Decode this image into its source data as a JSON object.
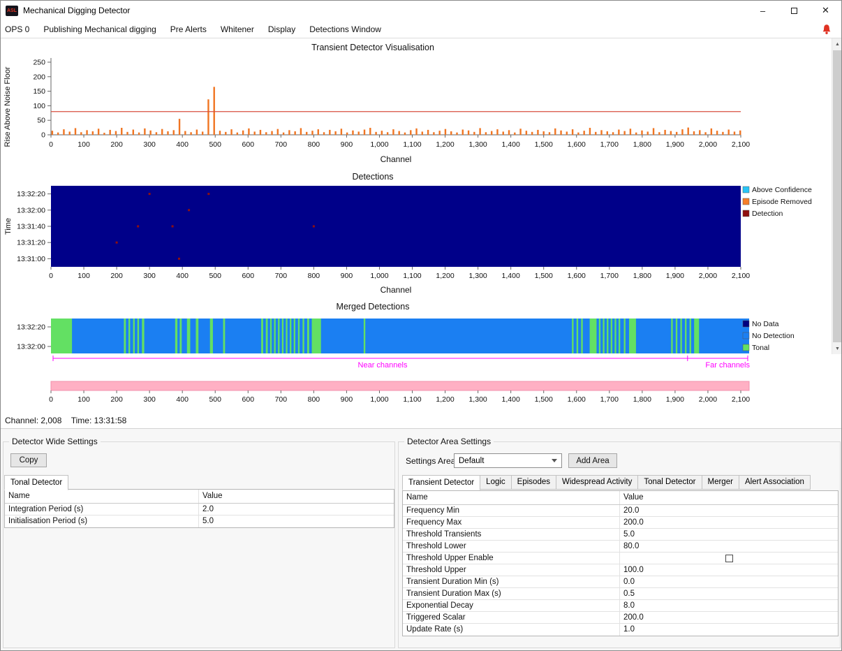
{
  "window": {
    "title": "Mechanical Digging Detector",
    "icon_text": "ASL"
  },
  "icons": {
    "minimize": "–",
    "maximize": "maximize-box",
    "close": "✕",
    "scroll_up": "▲",
    "scroll_down": "▼",
    "bell": "alert-bell",
    "combo_chevron": "chevron-down"
  },
  "menu": {
    "items": [
      "OPS 0",
      "Publishing Mechanical digging",
      "Pre Alerts",
      "Whitener",
      "Display",
      "Detections Window"
    ]
  },
  "status_bar": {
    "channel": "Channel: 2,008",
    "time": "Time: 13:31:58"
  },
  "chart_data": [
    {
      "id": "transient",
      "type": "bar",
      "title": "Transient Detector Visualisation",
      "xlabel": "Channel",
      "ylabel": "Rise Above Noise Floor",
      "xlim": [
        0,
        2100
      ],
      "ylim": [
        0,
        260
      ],
      "yticks": [
        0,
        50,
        100,
        150,
        200,
        250
      ],
      "xtick_step": 100,
      "threshold_line_y": 80,
      "threshold_color": "#d94f3f",
      "bar_color": "#f07522",
      "bars": {
        "x_start": 4,
        "x_step": 17.6,
        "values": [
          14,
          8,
          19,
          11,
          23,
          9,
          16,
          12,
          21,
          7,
          17,
          13,
          24,
          10,
          18,
          8,
          22,
          15,
          9,
          20,
          12,
          16,
          55,
          13,
          9,
          18,
          11,
          122,
          165,
          14,
          10,
          19,
          8,
          15,
          22,
          11,
          17,
          9,
          13,
          20,
          8,
          16,
          12,
          23,
          10,
          14,
          19,
          9,
          17,
          12,
          21,
          8,
          15,
          11,
          18,
          24,
          10,
          14,
          9,
          19,
          13,
          8,
          16,
          22,
          11,
          17,
          9,
          14,
          20,
          12,
          8,
          18,
          15,
          10,
          23,
          9,
          13,
          19,
          11,
          16,
          8,
          21,
          14,
          10,
          17,
          12,
          9,
          22,
          15,
          11,
          19,
          8,
          14,
          24,
          10,
          16,
          12,
          9,
          18,
          13,
          21,
          8,
          15,
          11,
          23,
          9,
          17,
          13,
          10,
          19,
          25,
          12,
          16,
          9,
          22,
          14,
          10,
          18,
          11,
          15
        ]
      }
    },
    {
      "id": "detections",
      "type": "heatmap",
      "title": "Detections",
      "xlabel": "Channel",
      "ylabel": "Time",
      "xlim": [
        0,
        2100
      ],
      "xtick_step": 100,
      "ytick_labels": [
        "13:32:20",
        "13:32:00",
        "13:31:40",
        "13:31:20",
        "13:31:00"
      ],
      "background_color": "#000089",
      "legend": [
        {
          "label": "Above Confidence",
          "color": "#29c5f6"
        },
        {
          "label": "Episode Removed",
          "color": "#f67e29"
        },
        {
          "label": "Detection",
          "color": "#8f1010"
        }
      ],
      "points": [
        {
          "channel": 300,
          "row": 0,
          "color": "#8f1010"
        },
        {
          "channel": 480,
          "row": 0,
          "color": "#8f1010"
        },
        {
          "channel": 420,
          "row": 1,
          "color": "#8f1010"
        },
        {
          "channel": 265,
          "row": 2,
          "color": "#8f1010"
        },
        {
          "channel": 370,
          "row": 2,
          "color": "#8f1010"
        },
        {
          "channel": 800,
          "row": 2,
          "color": "#8f1010"
        },
        {
          "channel": 200,
          "row": 3,
          "color": "#8f1010"
        },
        {
          "channel": 390,
          "row": 4,
          "color": "#8f1010"
        }
      ]
    },
    {
      "id": "merged",
      "type": "timeline",
      "title": "Merged Detections",
      "xlim": [
        0,
        2100
      ],
      "ytick_labels": [
        "13:32:20",
        "13:32:00"
      ],
      "base_color": "#1b7ff2",
      "tonal_color": "#63e063",
      "legend": [
        {
          "label": "No Data",
          "color": "#000080"
        },
        {
          "label": "No Detection",
          "color": "#1b7ff2"
        },
        {
          "label": "Tonal",
          "color": "#63e063"
        }
      ],
      "tonal_segments": [
        [
          0,
          64
        ],
        [
          222,
          228
        ],
        [
          236,
          241
        ],
        [
          250,
          255
        ],
        [
          263,
          268
        ],
        [
          277,
          284
        ],
        [
          378,
          385
        ],
        [
          392,
          398
        ],
        [
          414,
          424
        ],
        [
          441,
          449
        ],
        [
          484,
          493
        ],
        [
          524,
          530
        ],
        [
          640,
          646
        ],
        [
          654,
          660
        ],
        [
          667,
          672
        ],
        [
          679,
          684
        ],
        [
          691,
          696
        ],
        [
          703,
          708
        ],
        [
          715,
          720
        ],
        [
          727,
          732
        ],
        [
          739,
          744
        ],
        [
          752,
          757
        ],
        [
          766,
          771
        ],
        [
          780,
          786
        ],
        [
          794,
          822
        ],
        [
          952,
          957
        ],
        [
          1586,
          1591
        ],
        [
          1600,
          1605
        ],
        [
          1614,
          1619
        ],
        [
          1640,
          1661
        ],
        [
          1668,
          1673
        ],
        [
          1680,
          1685
        ],
        [
          1692,
          1697
        ],
        [
          1704,
          1709
        ],
        [
          1716,
          1721
        ],
        [
          1728,
          1733
        ],
        [
          1744,
          1749
        ],
        [
          1760,
          1781
        ],
        [
          1888,
          1893
        ],
        [
          1902,
          1907
        ],
        [
          1916,
          1921
        ],
        [
          1930,
          1935
        ],
        [
          1944,
          1949
        ],
        [
          1958,
          1973
        ]
      ],
      "near_far": {
        "near_label": "Near channels",
        "far_label": "Far channels",
        "color": "#ff00ff",
        "split_channel": 1938
      }
    },
    {
      "id": "overview",
      "type": "strip",
      "color": "#ffb0c4",
      "border_color": "#f290ad",
      "xlim": [
        0,
        2100
      ],
      "xtick_step": 100
    }
  ],
  "detector_wide": {
    "group_title": "Detector Wide Settings",
    "copy_button": "Copy",
    "tabs": [
      "Tonal Detector"
    ],
    "selected_tab": "Tonal Detector",
    "table": {
      "columns": [
        "Name",
        "Value"
      ],
      "rows": [
        {
          "name": "Integration Period (s)",
          "value": "2.0"
        },
        {
          "name": "Initialisation Period (s)",
          "value": "5.0"
        }
      ]
    }
  },
  "detector_area": {
    "group_title": "Detector Area Settings",
    "settings_area_label": "Settings Area:",
    "settings_area_value": "Default",
    "add_area_button": "Add Area",
    "tabs": [
      "Transient Detector",
      "Logic",
      "Episodes",
      "Widespread Activity",
      "Tonal Detector",
      "Merger",
      "Alert Association"
    ],
    "selected_tab": "Transient Detector",
    "table": {
      "columns": [
        "Name",
        "Value"
      ],
      "rows": [
        {
          "name": "Frequency Min",
          "value": "20.0"
        },
        {
          "name": "Frequency Max",
          "value": "200.0"
        },
        {
          "name": "Threshold Transients",
          "value": "5.0"
        },
        {
          "name": "Threshold Lower",
          "value": "80.0"
        },
        {
          "name": "Threshold Upper Enable",
          "value": "",
          "checkbox": true,
          "checked": false
        },
        {
          "name": "Threshold Upper",
          "value": "100.0"
        },
        {
          "name": "Transient Duration Min (s)",
          "value": "0.0"
        },
        {
          "name": "Transient Duration Max (s)",
          "value": "0.5"
        },
        {
          "name": "Exponential Decay",
          "value": "8.0"
        },
        {
          "name": "Triggered Scalar",
          "value": "200.0"
        },
        {
          "name": "Update Rate (s)",
          "value": "1.0"
        }
      ]
    }
  }
}
